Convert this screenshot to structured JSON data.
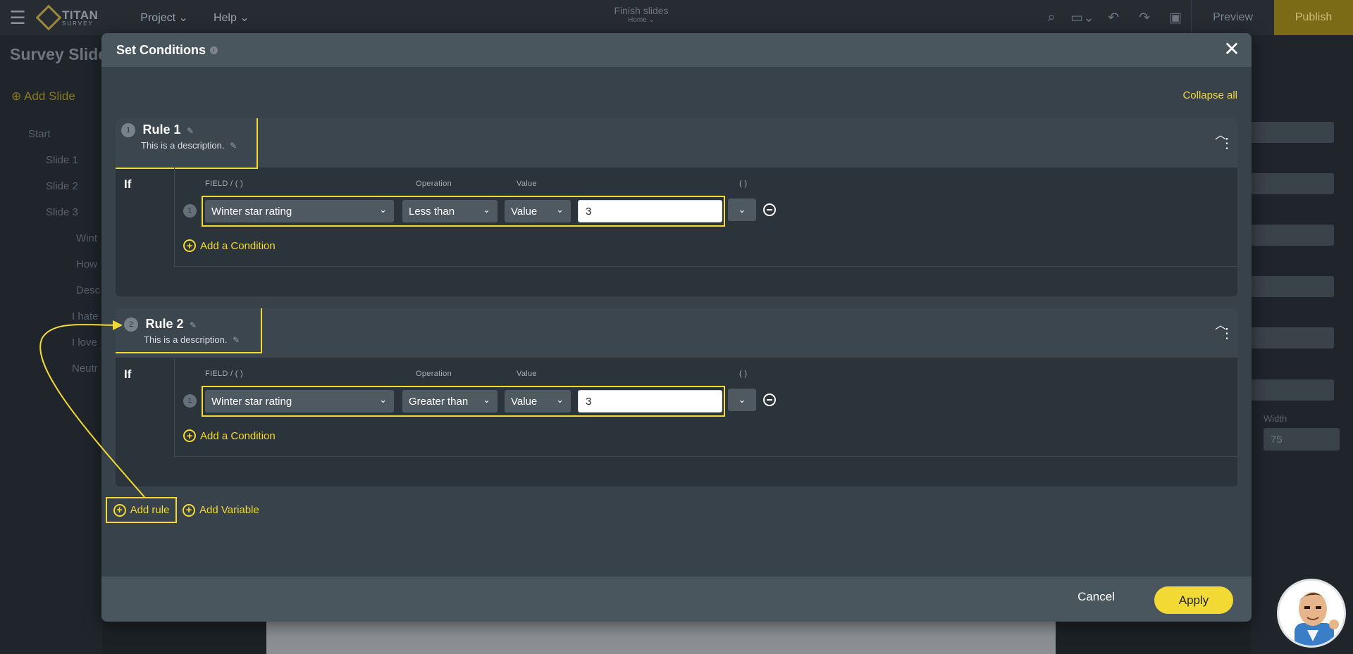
{
  "app": {
    "logo_title": "TITAN",
    "logo_sub": "SURVEY",
    "menu": [
      "Project",
      "Help"
    ],
    "center_title": "Finish slides",
    "center_sub": "Home",
    "preview_label": "Preview",
    "publish_label": "Publish"
  },
  "background": {
    "page_title": "Survey Slide",
    "add_slide": "Add Slide",
    "tree": [
      "Start",
      "Slide 1",
      "Slide 2",
      "Slide 3",
      "Wint",
      "How",
      "Desc",
      "I hate",
      "I love",
      "Neutr"
    ],
    "width_label": "Width",
    "width_value": "75"
  },
  "modal": {
    "title": "Set Conditions",
    "collapse_all": "Collapse all",
    "if_label": "If",
    "column_headers": {
      "field": "FIELD / ( )",
      "operation": "Operation",
      "value": "Value",
      "paren": "( )"
    },
    "add_condition": "Add a Condition",
    "rules": [
      {
        "number": "1",
        "name": "Rule 1",
        "description": "This is a description.",
        "conditions": [
          {
            "number": "1",
            "field": "Winter star rating",
            "operation": "Less than",
            "value_type": "Value",
            "value": "3"
          }
        ]
      },
      {
        "number": "2",
        "name": "Rule 2",
        "description": "This is a description.",
        "conditions": [
          {
            "number": "1",
            "field": "Winter star rating",
            "operation": "Greater than",
            "value_type": "Value",
            "value": "3"
          }
        ]
      }
    ],
    "add_rule": "Add rule",
    "add_variable": "Add Variable",
    "cancel": "Cancel",
    "apply": "Apply"
  },
  "colors": {
    "accent": "#f2d933",
    "modal_bg": "#38424a",
    "header_bg": "#4a565e"
  }
}
